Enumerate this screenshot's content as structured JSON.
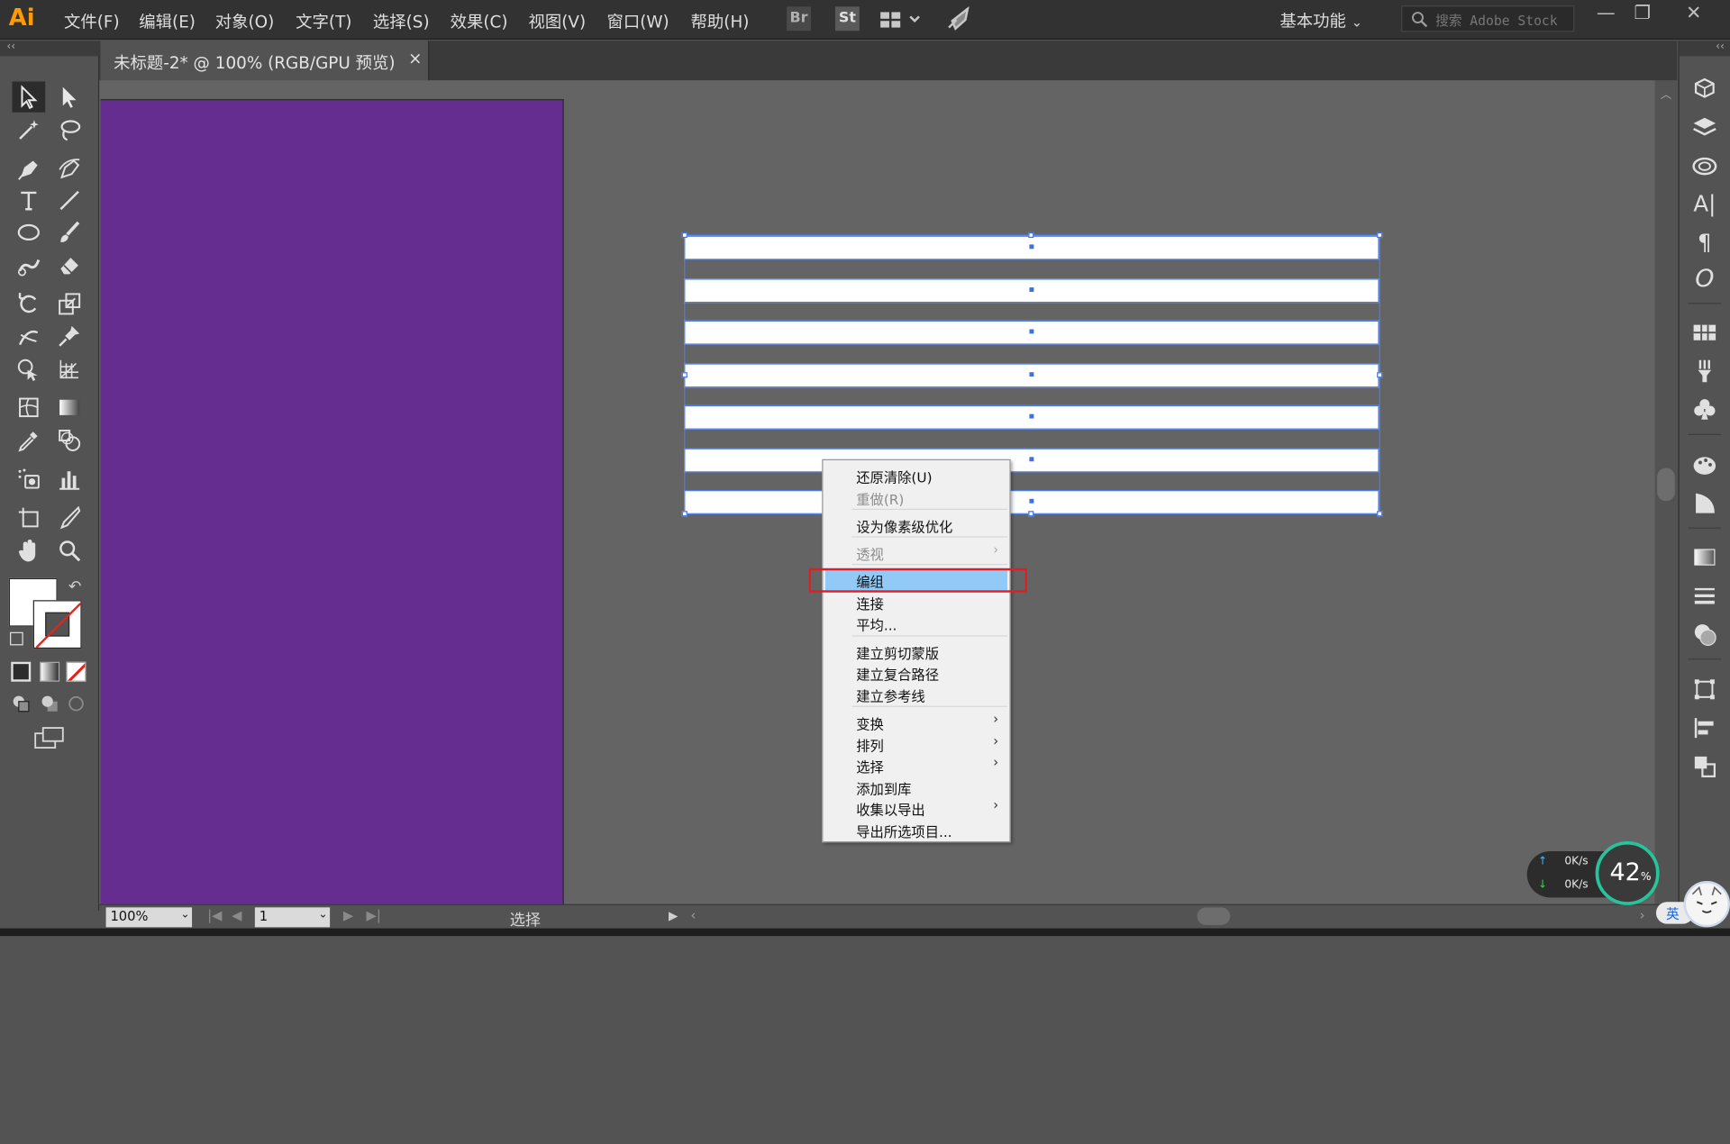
{
  "app": {
    "logo": "Ai",
    "menu": [
      "文件(F)",
      "编辑(E)",
      "对象(O)",
      "文字(T)",
      "选择(S)",
      "效果(C)",
      "视图(V)",
      "窗口(W)",
      "帮助(H)"
    ],
    "bridge_label": "Br",
    "stock_label": "St",
    "workspace": "基本功能",
    "search_placeholder": "搜索 Adobe Stock",
    "window_min": "—",
    "window_restore": "❐",
    "window_close": "✕",
    "panel_collapse_left": "‹‹",
    "panel_collapse_right": "‹‹"
  },
  "document": {
    "tab_title": "未标题-2* @ 100% (RGB/GPU 预览)",
    "tab_close": "×",
    "artboard_color": "#652d90"
  },
  "selection": {
    "stripe_count": 7
  },
  "context_menu": {
    "groups": [
      [
        {
          "label": "还原清除(U)",
          "disabled": false,
          "submenu": false
        },
        {
          "label": "重做(R)",
          "disabled": true,
          "submenu": false
        }
      ],
      [
        {
          "label": "设为像素级优化",
          "disabled": false,
          "submenu": false
        }
      ],
      [
        {
          "label": "透视",
          "disabled": true,
          "submenu": true
        }
      ],
      [
        {
          "label": "编组",
          "disabled": false,
          "submenu": false,
          "highlighted": true
        },
        {
          "label": "连接",
          "disabled": false,
          "submenu": false
        },
        {
          "label": "平均...",
          "disabled": false,
          "submenu": false
        }
      ],
      [
        {
          "label": "建立剪切蒙版",
          "disabled": false,
          "submenu": false
        },
        {
          "label": "建立复合路径",
          "disabled": false,
          "submenu": false
        },
        {
          "label": "建立参考线",
          "disabled": false,
          "submenu": false
        }
      ],
      [
        {
          "label": "变换",
          "disabled": false,
          "submenu": true
        },
        {
          "label": "排列",
          "disabled": false,
          "submenu": true
        },
        {
          "label": "选择",
          "disabled": false,
          "submenu": true
        },
        {
          "label": "添加到库",
          "disabled": false,
          "submenu": false
        },
        {
          "label": "收集以导出",
          "disabled": false,
          "submenu": true
        },
        {
          "label": "导出所选项目...",
          "disabled": false,
          "submenu": false
        }
      ]
    ],
    "highlight_color": "#91c9f7",
    "annotation_color": "#e51c23"
  },
  "statusbar": {
    "zoom": "100%",
    "page": "1",
    "tool_name": "选择"
  },
  "overlay": {
    "upload_speed": "0K/s",
    "download_speed": "0K/s",
    "cpu_percent": "42",
    "cpu_unit": "%",
    "ime_label": "英"
  },
  "tools": [
    "selection-tool",
    "direct-selection-tool",
    "magic-wand-tool",
    "lasso-tool",
    "pen-tool",
    "curvature-tool",
    "type-tool",
    "line-tool",
    "ellipse-tool",
    "paintbrush-tool",
    "shaper-tool",
    "eraser-tool",
    "rotate-tool",
    "scale-tool",
    "warp-tool",
    "puppet-warp-tool",
    "shape-builder-tool",
    "perspective-grid-tool",
    "mesh-tool",
    "gradient-tool",
    "eyedropper-tool",
    "blend-tool",
    "symbol-sprayer-tool",
    "column-graph-tool",
    "artboard-tool",
    "slice-tool",
    "hand-tool",
    "zoom-tool"
  ],
  "right_panels": [
    "libraries",
    "layers",
    "creative-cloud",
    "character",
    "paragraph",
    "opentype",
    "swatches",
    "brushes",
    "symbols",
    "graphic-styles",
    "appearance",
    "gradient",
    "stroke",
    "transparency",
    "transform",
    "align",
    "pathfinder"
  ]
}
